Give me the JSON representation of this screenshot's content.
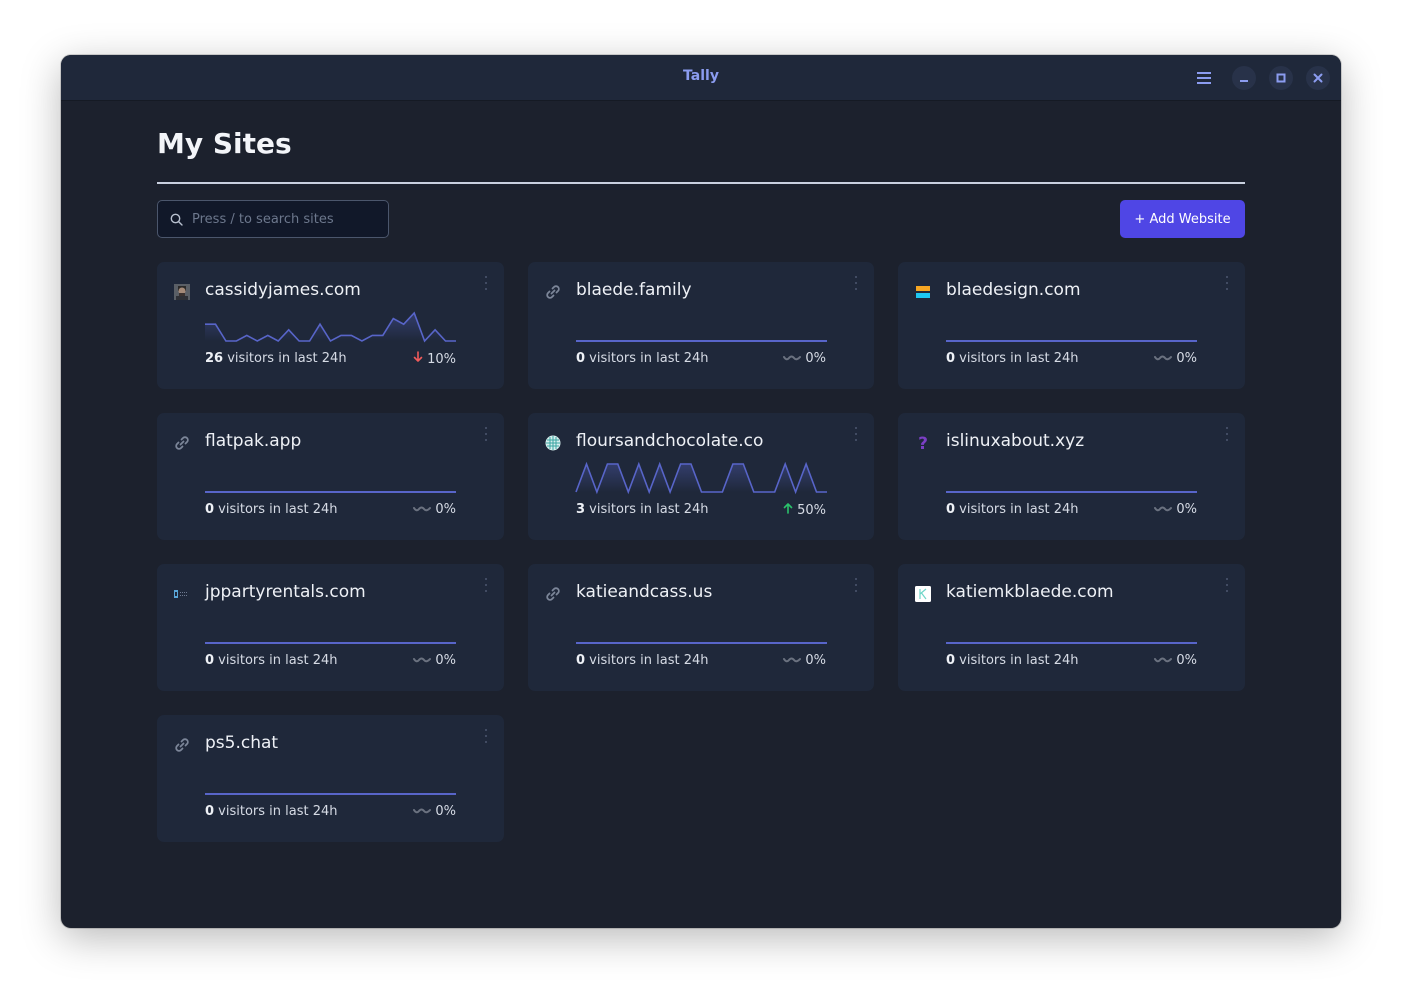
{
  "window": {
    "title": "Tally",
    "controls": {
      "menu_icon": "hamburger-menu-icon",
      "minimize_icon": "minimize-icon",
      "maximize_icon": "maximize-icon",
      "close_icon": "close-icon"
    }
  },
  "header": {
    "title": "My Sites"
  },
  "toolbar": {
    "search_placeholder": "Press / to search sites",
    "search_value": "",
    "search_icon": "search-icon",
    "add_label": "+ Add Website"
  },
  "colors": {
    "accent": "#4f46e5",
    "sparkline": "#5865c9",
    "trend_down": "#f05b5b",
    "trend_up": "#2bc26b",
    "trend_flat": "#6b7280",
    "title_color": "#8b9cf0"
  },
  "sites": [
    {
      "name": "cassidyjames.com",
      "favicon": "photo-avatar",
      "visitors": "26",
      "visitors_suffix": " visitors in last 24h",
      "trend": "down",
      "change": "10%",
      "series": [
        3,
        3,
        0,
        0,
        1,
        0,
        1,
        0,
        2,
        0,
        0,
        3,
        0,
        1,
        1,
        0,
        1,
        1,
        4,
        3,
        5,
        0,
        2,
        0,
        0
      ]
    },
    {
      "name": "blaede.family",
      "favicon": "link",
      "visitors": "0",
      "visitors_suffix": " visitors in last 24h",
      "trend": "flat",
      "change": "0%",
      "series": []
    },
    {
      "name": "blaedesign.com",
      "favicon": "stripes",
      "visitors": "0",
      "visitors_suffix": " visitors in last 24h",
      "trend": "flat",
      "change": "0%",
      "series": []
    },
    {
      "name": "flatpak.app",
      "favicon": "link",
      "visitors": "0",
      "visitors_suffix": " visitors in last 24h",
      "trend": "flat",
      "change": "0%",
      "series": []
    },
    {
      "name": "floursandchocolate.co",
      "favicon": "globe",
      "visitors": "3",
      "visitors_suffix": " visitors in last 24h",
      "trend": "up",
      "change": "50%",
      "series": [
        0,
        1,
        0,
        1,
        1,
        0,
        1,
        0,
        1,
        0,
        1,
        1,
        0,
        0,
        0,
        1,
        1,
        0,
        0,
        0,
        1,
        0,
        1,
        0,
        0
      ]
    },
    {
      "name": "islinuxabout.xyz",
      "favicon": "question",
      "visitors": "0",
      "visitors_suffix": " visitors in last 24h",
      "trend": "flat",
      "change": "0%",
      "series": []
    },
    {
      "name": "jppartyrentals.com",
      "favicon": "logo-small",
      "visitors": "0",
      "visitors_suffix": " visitors in last 24h",
      "trend": "flat",
      "change": "0%",
      "series": []
    },
    {
      "name": "katieandcass.us",
      "favicon": "link",
      "visitors": "0",
      "visitors_suffix": " visitors in last 24h",
      "trend": "flat",
      "change": "0%",
      "series": []
    },
    {
      "name": "katiemkblaede.com",
      "favicon": "letter-k",
      "visitors": "0",
      "visitors_suffix": " visitors in last 24h",
      "trend": "flat",
      "change": "0%",
      "series": []
    },
    {
      "name": "ps5.chat",
      "favicon": "link",
      "visitors": "0",
      "visitors_suffix": " visitors in last 24h",
      "trend": "flat",
      "change": "0%",
      "series": []
    }
  ]
}
